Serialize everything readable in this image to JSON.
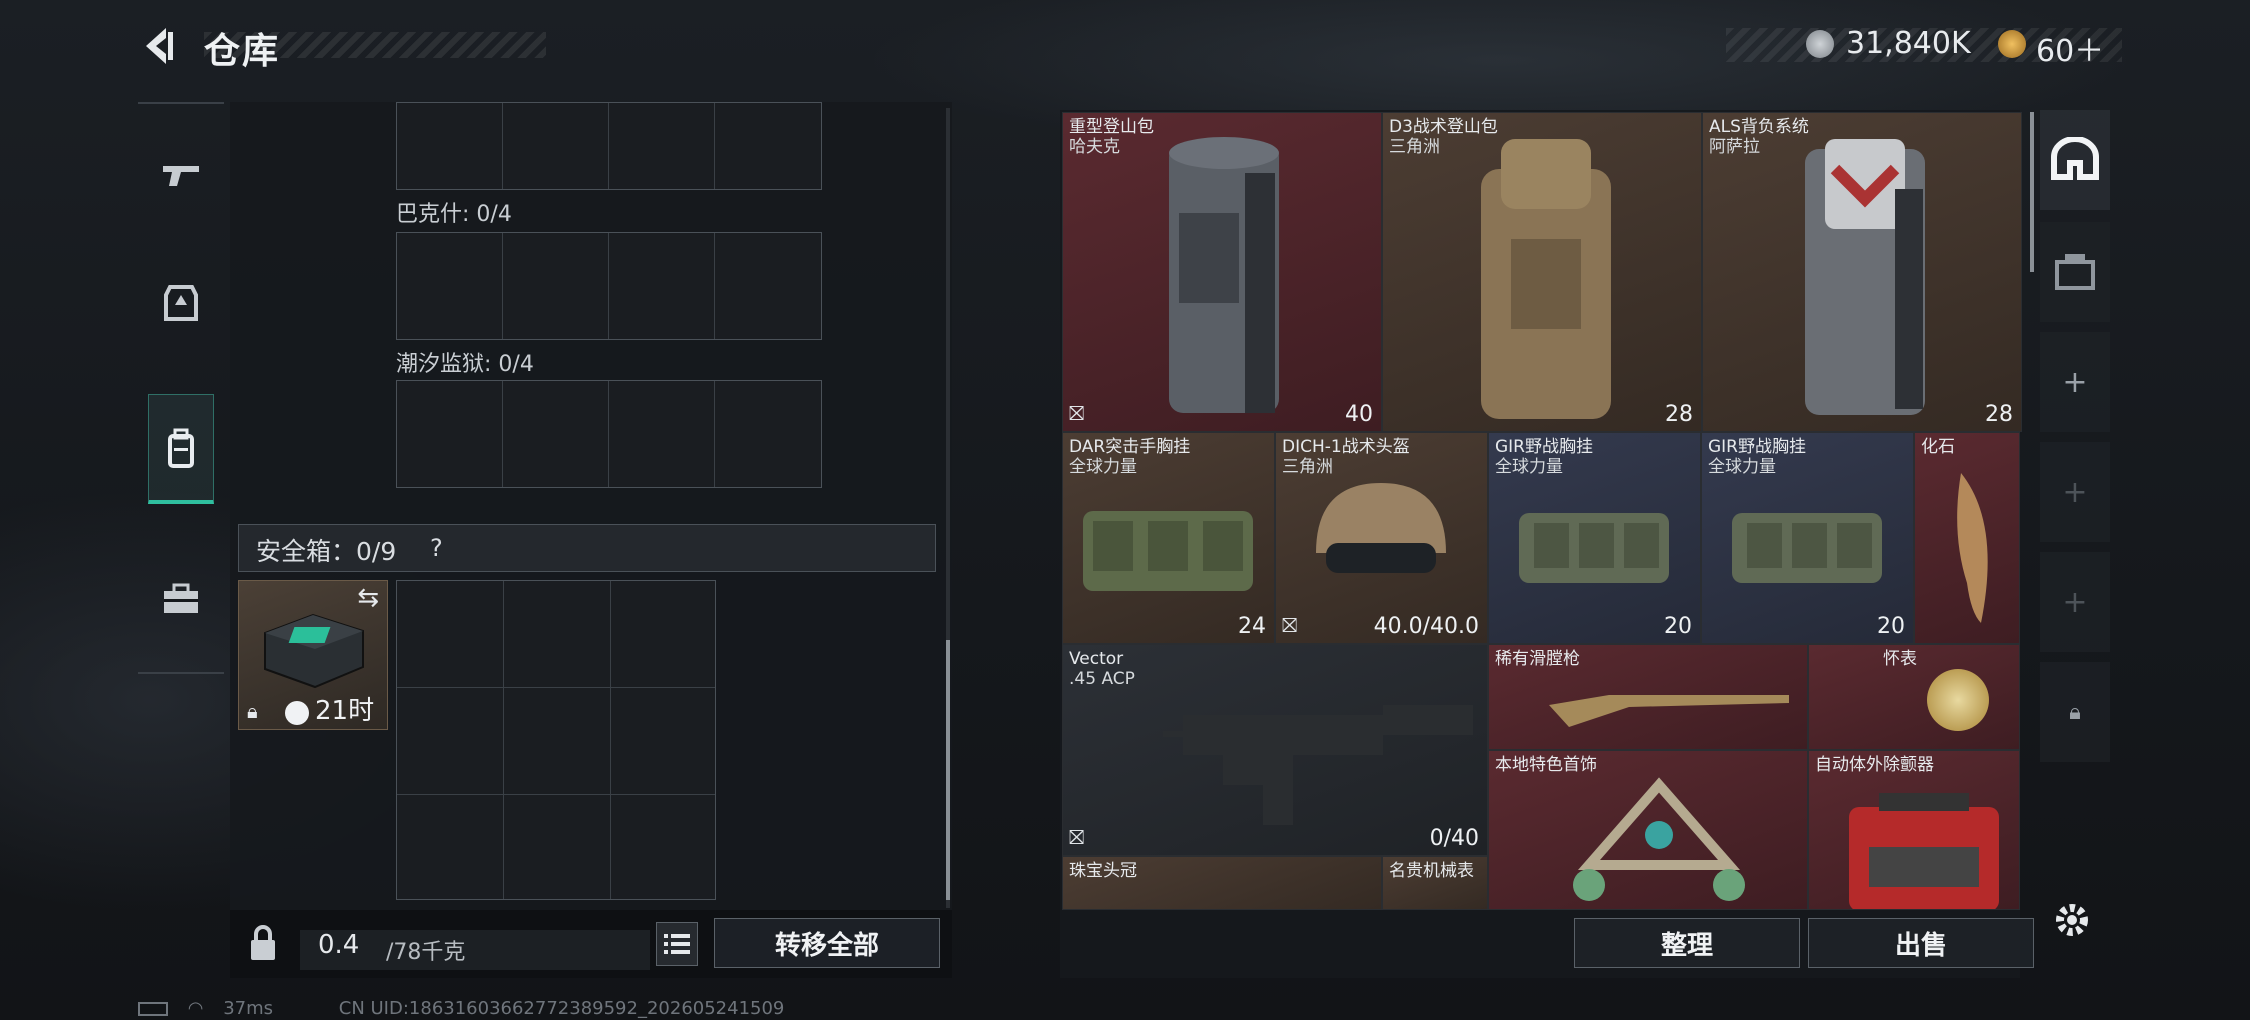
{
  "header": {
    "title": "仓库",
    "silver": "31,840K",
    "gold": "60＋"
  },
  "containers": [
    {
      "label": "巴克什: 0/4"
    },
    {
      "label": "潮汐监狱: 0/4"
    }
  ],
  "safe": {
    "label": "安全箱：0/9",
    "help": "?",
    "time": "21时"
  },
  "items": [
    {
      "name": "重型登山包",
      "sub": "哈夫克",
      "value": "40"
    },
    {
      "name": "D3战术登山包",
      "sub": "三角洲",
      "value": "28"
    },
    {
      "name": "ALS背负系统",
      "sub": "阿萨拉",
      "value": "28"
    },
    {
      "name": "DAR突击手胸挂",
      "sub": "全球力量",
      "value": "24"
    },
    {
      "name": "DICH-1战术头盔",
      "sub": "三角洲",
      "value": "40.0/40.0"
    },
    {
      "name": "GIR野战胸挂",
      "sub": "全球力量",
      "value": "20"
    },
    {
      "name": "GIR野战胸挂",
      "sub": "全球力量",
      "value": "20"
    },
    {
      "name": "化石"
    },
    {
      "name": "Vector",
      "sub": ".45 ACP",
      "value": "0/40"
    },
    {
      "name": "稀有滑膛枪"
    },
    {
      "name": "怀表"
    },
    {
      "name": "本地特色首饰"
    },
    {
      "name": "自动体外除颤器"
    },
    {
      "name": "珠宝头冠"
    },
    {
      "name": "名贵机械表"
    }
  ],
  "footer": {
    "weight": "0.4",
    "capacity": "/78千克",
    "transfer_all": "转移全部",
    "sort": "整理",
    "sell": "出售"
  },
  "status": {
    "ping": "37ms",
    "uid": "CN UID:18631603662772389592_202605241509"
  }
}
